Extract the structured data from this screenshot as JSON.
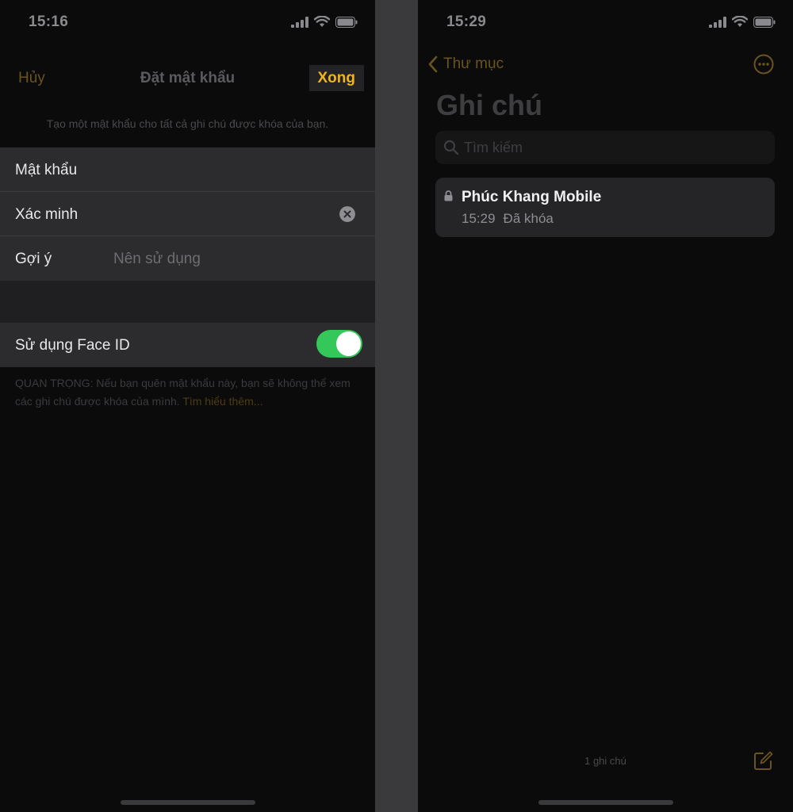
{
  "left_screen": {
    "status": {
      "time": "15:16"
    },
    "nav": {
      "cancel": "Hủy",
      "title": "Đặt mật khẩu",
      "done": "Xong"
    },
    "description": "Tạo một mật khẩu cho tất cả ghi chú được khóa của bạn.",
    "form": {
      "password_label": "Mật khẩu",
      "verify_label": "Xác minh",
      "hint_label": "Gợi ý",
      "hint_placeholder": "Nên sử dụng"
    },
    "face_id": {
      "label": "Sử dụng Face ID",
      "enabled": true
    },
    "footer": {
      "text": "QUAN TRỌNG: Nếu bạn quên mật khẩu này, bạn sẽ không thể xem các ghi chú được khóa của mình. ",
      "link": "Tìm hiểu thêm..."
    }
  },
  "right_screen": {
    "status": {
      "time": "15:29"
    },
    "nav": {
      "back_label": "Thư mục"
    },
    "title": "Ghi chú",
    "search": {
      "placeholder": "Tìm kiếm"
    },
    "notes": [
      {
        "title": "Phúc Khang Mobile",
        "time": "15:29",
        "status": "Đã khóa",
        "locked": true
      }
    ],
    "footer": {
      "count": "1 ghi chú"
    }
  },
  "colors": {
    "accent": "#f2b31b",
    "accent_dimmed": "#6b5320",
    "toggle_on": "#34c759",
    "background": "#0b0b0b",
    "cell_background": "#2c2c2e",
    "divider": "#3a3a3c"
  },
  "icons": [
    "signal-icon",
    "wifi-icon",
    "battery-icon",
    "clear-icon",
    "chevron-left-icon",
    "more-icon",
    "search-icon",
    "lock-icon",
    "compose-icon"
  ]
}
